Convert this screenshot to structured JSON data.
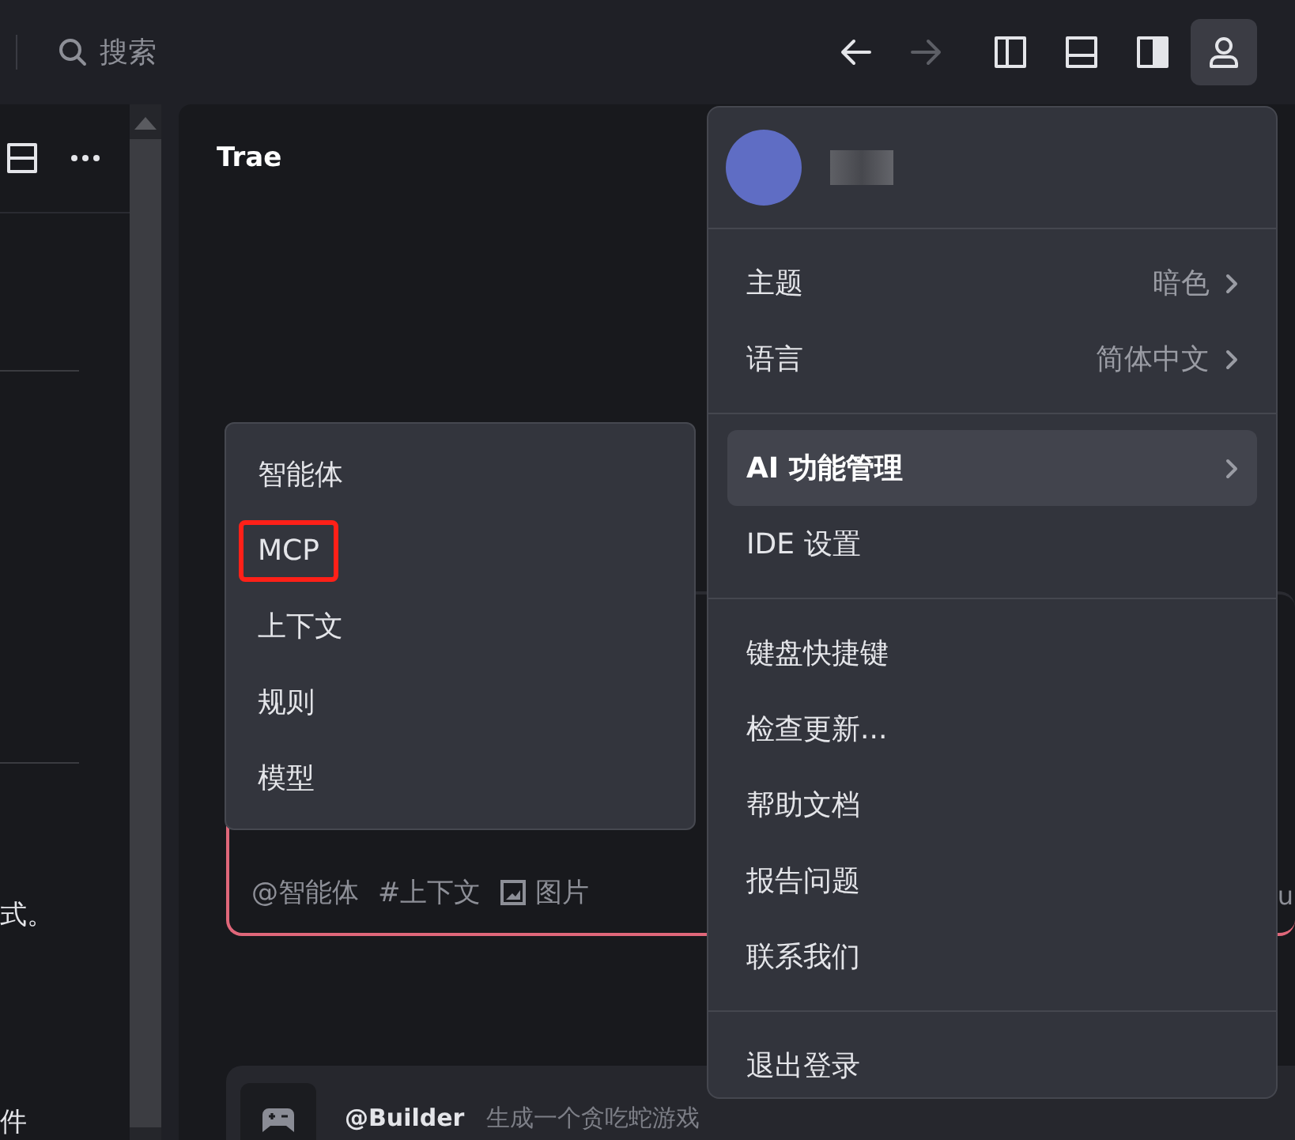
{
  "topbar": {
    "search": {
      "placeholder": "搜索"
    },
    "nav": [
      {
        "kind": "back",
        "disabled": false
      },
      {
        "kind": "forward",
        "disabled": true
      }
    ],
    "layout_buttons": [
      {
        "kind": "left"
      },
      {
        "kind": "bottom"
      },
      {
        "kind": "right"
      }
    ],
    "account_button": {
      "active": true
    }
  },
  "left_panel": {
    "texts": [
      "式。",
      "件"
    ]
  },
  "chat": {
    "title": "Trae",
    "chips": [
      {
        "kind": "mention",
        "label": "@智能体"
      },
      {
        "kind": "hash",
        "label": "#上下文"
      },
      {
        "kind": "image",
        "label": "图片"
      }
    ],
    "edge_text": "u",
    "suggestion": {
      "agent": "@Builder",
      "text": "生成一个贪吃蛇游戏"
    }
  },
  "context_menu": {
    "items": [
      {
        "label": "智能体",
        "annotated": false
      },
      {
        "label": "MCP",
        "annotated": true
      },
      {
        "label": "上下文",
        "annotated": false
      },
      {
        "label": "规则",
        "annotated": false
      },
      {
        "label": "模型",
        "annotated": false
      }
    ]
  },
  "user_menu": {
    "groups": [
      [
        {
          "label": "主题",
          "value": "暗色",
          "submenu": true,
          "selected": false
        },
        {
          "label": "语言",
          "value": "简体中文",
          "submenu": true,
          "selected": false
        }
      ],
      [
        {
          "label": "AI 功能管理",
          "submenu": true,
          "selected": true
        },
        {
          "label": "IDE 设置",
          "submenu": false,
          "selected": false
        }
      ],
      [
        {
          "label": "键盘快捷键",
          "submenu": false,
          "selected": false
        },
        {
          "label": "检查更新...",
          "submenu": false,
          "selected": false
        },
        {
          "label": "帮助文档",
          "submenu": false,
          "selected": false
        },
        {
          "label": "报告问题",
          "submenu": false,
          "selected": false
        },
        {
          "label": "联系我们",
          "submenu": false,
          "selected": false
        }
      ],
      [
        {
          "label": "退出登录",
          "submenu": false,
          "selected": false
        }
      ]
    ]
  }
}
